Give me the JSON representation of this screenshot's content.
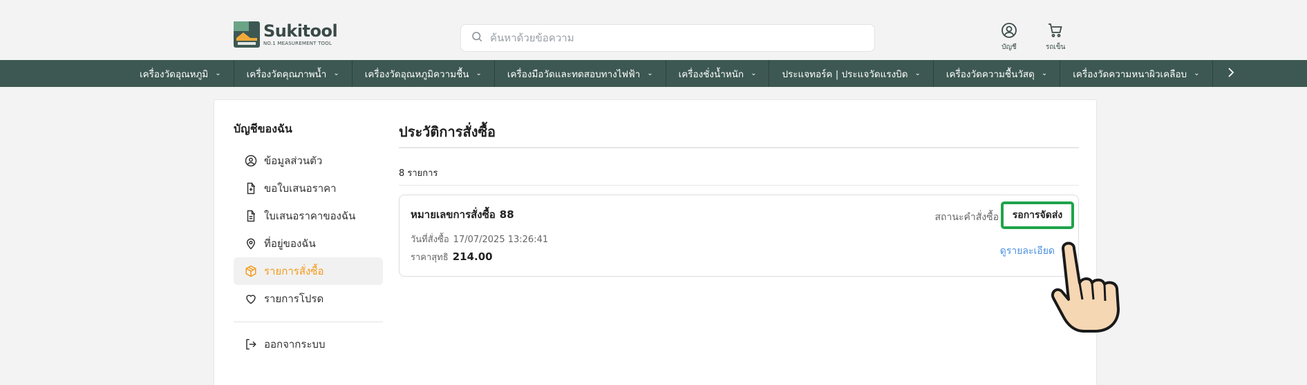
{
  "brand": {
    "name": "Sukitool",
    "tagline": "NO.1 MEASUREMENT TOOL",
    "colors": {
      "dark": "#3d5852",
      "accent_orange": "#f29b1c",
      "accent_green": "#1fa34a",
      "link": "#4a90e2"
    }
  },
  "search": {
    "placeholder": "ค้นหาด้วยข้อความ",
    "icon": "search-icon"
  },
  "header_actions": [
    {
      "label": "บัญชี",
      "icon": "user-circle-icon"
    },
    {
      "label": "รถเข็น",
      "icon": "cart-icon"
    }
  ],
  "nav": {
    "items": [
      "เครื่องวัดอุณหภูมิ",
      "เครื่องวัดคุณภาพน้ำ",
      "เครื่องวัดอุณหภูมิความชื้น",
      "เครื่องมือวัดและทดสอบทางไฟฟ้า",
      "เครื่องชั่งน้ำหนัก",
      "ประแจทอร์ค | ประแจวัดแรงบิด",
      "เครื่องวัดความชื้นวัสดุ",
      "เครื่องวัดความหนาผิวเคลือบ"
    ],
    "next_icon": "chevron-right-icon"
  },
  "sidebar": {
    "title": "บัญชีของฉัน",
    "items": [
      {
        "label": "ข้อมูลส่วนตัว",
        "icon": "user-circle-icon",
        "active": false
      },
      {
        "label": "ขอใบเสนอราคา",
        "icon": "file-plus-icon",
        "active": false
      },
      {
        "label": "ใบเสนอราคาของฉัน",
        "icon": "document-icon",
        "active": false
      },
      {
        "label": "ที่อยู่ของฉัน",
        "icon": "map-pin-icon",
        "active": false
      },
      {
        "label": "รายการสั่งซื้อ",
        "icon": "package-icon",
        "active": true
      },
      {
        "label": "รายการโปรด",
        "icon": "heart-icon",
        "active": false
      }
    ],
    "logout": {
      "label": "ออกจากระบบ",
      "icon": "logout-icon"
    }
  },
  "main": {
    "title": "ประวัติการสั่งซื้อ",
    "count": "8 รายการ",
    "order": {
      "number_label": "หมายเลขการสั่งซื้อ",
      "number": "88",
      "date_label": "วันที่สั่งซื้อ",
      "date": "17/07/2025 13:26:41",
      "price_label": "ราคาสุทธิ",
      "price": "214.00",
      "status_label": "สถานะคำสั่งซื้อ",
      "status": "รอการจัดส่ง",
      "detail_link": "ดูรายละเอียด"
    }
  }
}
